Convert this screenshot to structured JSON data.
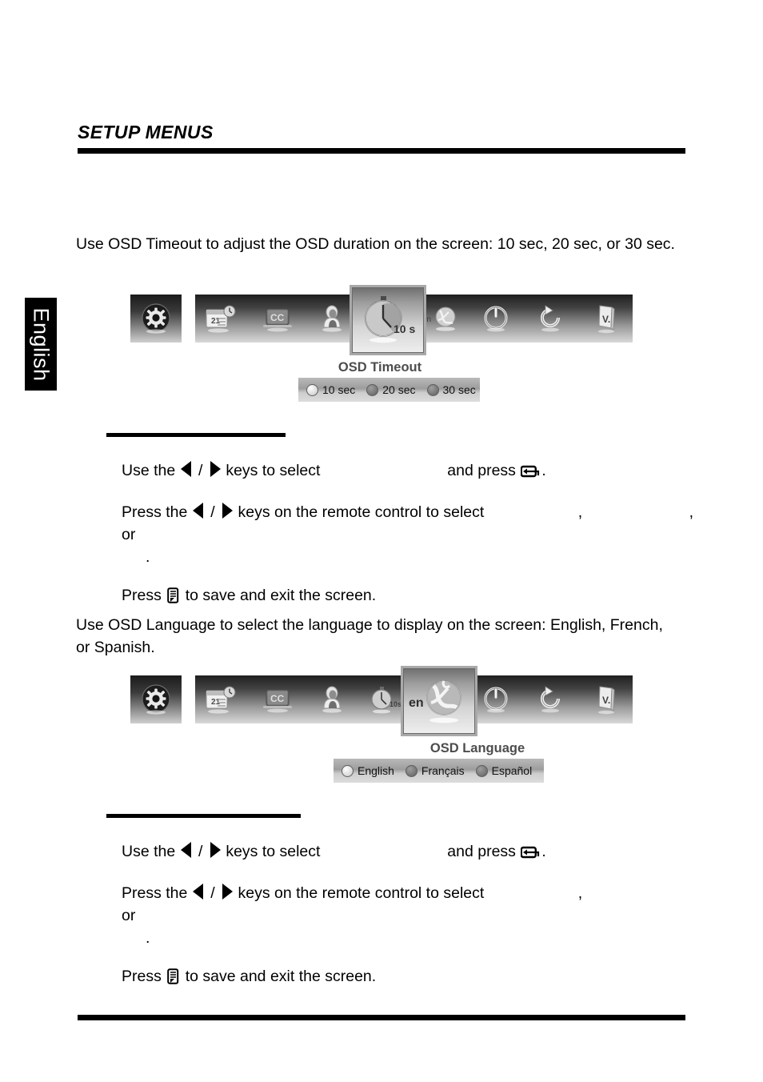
{
  "page": {
    "title": "SETUP MENUS",
    "side_tab": "English"
  },
  "sections": [
    {
      "intro": "Use OSD Timeout to adjust the OSD duration on the screen: 10 sec, 20 sec, or 30 sec.",
      "osd": {
        "selected_label": "OSD Timeout",
        "selected_icon": "timer-10s-icon",
        "gear_icon": "settings-gear-icon",
        "icons": [
          "calendar-timer-icon",
          "closed-caption-icon",
          "parental-control-icon",
          "timer-10s-icon",
          "language-globe-icon",
          "power-icon",
          "reset-icon",
          "version-document-icon"
        ],
        "options": [
          {
            "label": "10 sec",
            "selected": true
          },
          {
            "label": "20 sec",
            "selected": false
          },
          {
            "label": "30 sec",
            "selected": false
          }
        ]
      },
      "steps": {
        "s1_a": "Use the",
        "s1_slash": "/",
        "s1_b": "keys to select",
        "s1_c": "and press",
        "s1_d": ".",
        "s2_a": "Press the",
        "s2_slash": "/",
        "s2_b": "keys on the remote control to select",
        "s2_comma1": ",",
        "s2_comma2": ", or",
        "s2_end": ".",
        "s3_a": "Press",
        "s3_b": "to save and exit the screen."
      }
    },
    {
      "intro": "Use OSD Language to select the language to display on the screen: English, French, or Spanish.",
      "osd": {
        "selected_label": "OSD Language",
        "selected_icon": "language-globe-icon",
        "gear_icon": "settings-gear-icon",
        "icons": [
          "calendar-timer-icon",
          "closed-caption-icon",
          "parental-control-icon",
          "timer-10s-icon",
          "language-globe-icon",
          "power-icon",
          "reset-icon",
          "version-document-icon"
        ],
        "options": [
          {
            "label": "English",
            "selected": true
          },
          {
            "label": "Français",
            "selected": false
          },
          {
            "label": "Español",
            "selected": false
          }
        ]
      },
      "steps": {
        "s1_a": "Use the",
        "s1_slash": "/",
        "s1_b": "keys to select",
        "s1_c": "and press",
        "s1_d": ".",
        "s2_a": "Press the",
        "s2_slash": "/",
        "s2_b": "keys on the remote control to select",
        "s2_comma1": ",",
        "s2_comma2": "or",
        "s2_end": ".",
        "s3_a": "Press",
        "s3_b": "to save and exit the screen."
      }
    }
  ],
  "icon_glyphs": {
    "en_badge": "en",
    "timer_badge": "10 s",
    "timer_badge_small": "10s",
    "cc_badge": "CC",
    "calendar_badge": "21",
    "version_badge": "V."
  },
  "colors": {
    "rule": "#000000",
    "osd_label": "#4d4d4d",
    "tab_bg": "#000000",
    "tab_text": "#ffffff"
  }
}
